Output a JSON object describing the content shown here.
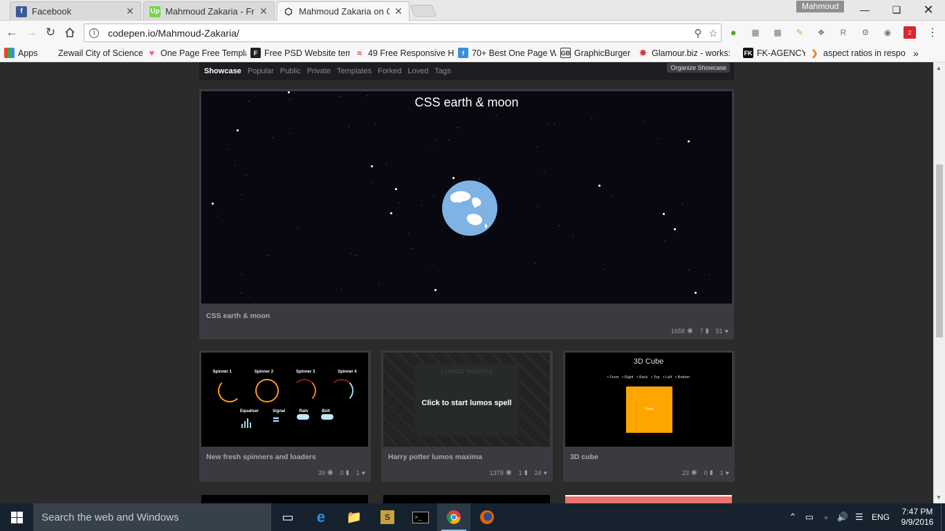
{
  "browser": {
    "tabs": [
      {
        "title": "Facebook",
        "close": "✕"
      },
      {
        "title": "Mahmoud Zakaria - Fron",
        "close": "✕"
      },
      {
        "title": "Mahmoud Zakaria on Co",
        "close": "✕"
      }
    ],
    "profile_name": "Mahmoud",
    "url": "codepen.io/Mahmoud-Zakaria/",
    "extension_badge": "2"
  },
  "bookmarks": [
    "Apps",
    "Zewail City of Science",
    "One Page Free Templa",
    "Free PSD Website tem",
    "49 Free Responsive H",
    "70+ Best One Page W",
    "GraphicBurger",
    "Glamour.biz - works:",
    "FK-AGENCY",
    "aspect ratios in respo"
  ],
  "subnav": {
    "items": [
      "Showcase",
      "Popular",
      "Public",
      "Private",
      "Templates",
      "Forked",
      "Loved",
      "Tags"
    ],
    "organize_label": "Organize Showcase"
  },
  "featured": {
    "preview_title": "CSS earth & moon",
    "name": "CSS earth & moon",
    "views": "1658",
    "comments": "7",
    "loves": "51"
  },
  "pens": [
    {
      "name": "New fresh spinners and loaders",
      "views": "39",
      "comments": "0",
      "loves": "1",
      "spinners": [
        "Spinner 1",
        "Spinner 2",
        "Spinner 3",
        "Spinner 4"
      ],
      "loaders": [
        "Equaliser",
        "Signal",
        "Rain",
        "Bolt"
      ]
    },
    {
      "name": "Harry potter lumos maxima",
      "views": "1378",
      "comments": "1",
      "loves": "24",
      "overlay_title": "Lumos maxima",
      "cta": "Click to start lumos spell"
    },
    {
      "name": "3D cube",
      "views": "23",
      "comments": "0",
      "loves": "1",
      "preview_title": "3D Cube",
      "faces": [
        "Front",
        "Right",
        "Back",
        "Top",
        "Left",
        "Bottom"
      ],
      "face_label": "Front"
    }
  ],
  "taskbar": {
    "search_placeholder": "Search the web and Windows",
    "language": "ENG",
    "time": "7:47 PM",
    "date": "9/9/2016"
  },
  "colors": {
    "page_bg": "#2b2b2b",
    "card_bg": "#3a3b40",
    "cube_orange": "#ffa500",
    "earth_blue": "#7fb3e3"
  }
}
